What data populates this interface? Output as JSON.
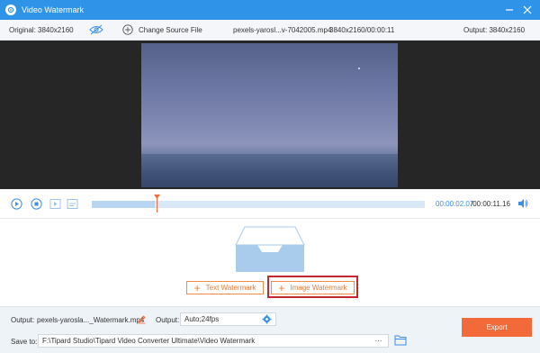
{
  "window": {
    "title": "Video Watermark",
    "title_icon": "app-logo-icon",
    "controls": [
      "minimize-icon",
      "close-icon"
    ]
  },
  "infobar": {
    "original": "Original: 3840x2160",
    "change_source": "Change Source File",
    "filename": "pexels-yarosl...v-7042005.mp4",
    "file_info": "3840x2160/00:00:11",
    "output": "Output: 3840x2160"
  },
  "playback": {
    "current_time": "00:00:02.07",
    "total_time": "/00:00:11.16",
    "progress_fraction": 0.19
  },
  "watermark": {
    "text_label": "Text Watermark",
    "image_label": "Image Watermark"
  },
  "bottom": {
    "output_label": "Output:",
    "output_file": "pexels-yarosla..._Watermark.mp4",
    "output_format_label": "Output:",
    "output_format": "Auto;24fps",
    "save_label": "Save to:",
    "save_path": "F:\\Tipard Studio\\Tipard Video Converter Ultimate\\Video Watermark",
    "more_label": "···",
    "export_label": "Export"
  },
  "colors": {
    "titlebar": "#2f94e8",
    "accent_orange": "#f26a3a",
    "highlight_red": "#c7282e",
    "time_blue": "#3a8ee6"
  }
}
